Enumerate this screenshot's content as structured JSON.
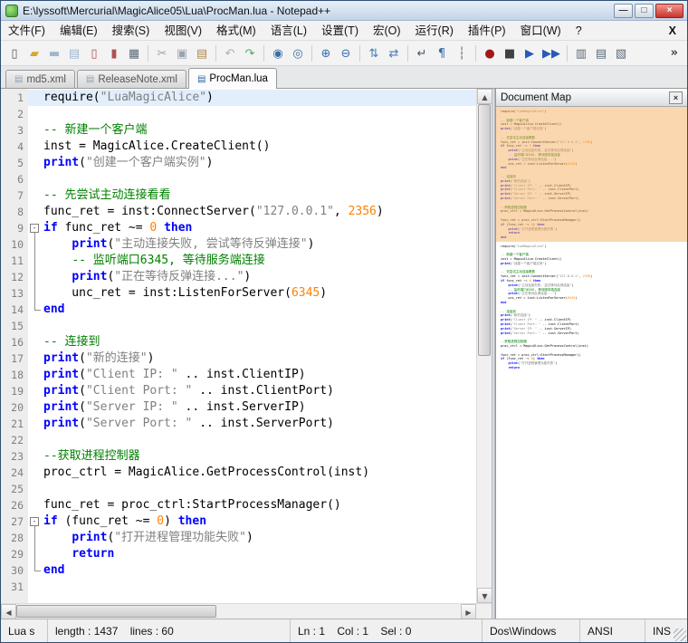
{
  "window": {
    "title": "E:\\lyssoft\\Mercurial\\MagicAlice05\\Lua\\ProcMan.lua - Notepad++",
    "buttons": {
      "minimize": "—",
      "maximize": "□",
      "close": "×"
    }
  },
  "menu": {
    "items": [
      "文件(F)",
      "编辑(E)",
      "搜索(S)",
      "视图(V)",
      "格式(M)",
      "语言(L)",
      "设置(T)",
      "宏(O)",
      "运行(R)",
      "插件(P)",
      "窗口(W)",
      "?"
    ],
    "close_label": "X"
  },
  "toolbar": {
    "overflow": "»",
    "items": [
      {
        "name": "new-file-icon",
        "glyph": "▯",
        "color": "#5a5a5a"
      },
      {
        "name": "open-folder-icon",
        "glyph": "▰",
        "color": "#d9a62e"
      },
      {
        "name": "save-icon",
        "glyph": "▬",
        "color": "#9fb6cf"
      },
      {
        "name": "save-all-icon",
        "glyph": "▤",
        "color": "#9fb6cf"
      },
      {
        "name": "close-doc-icon",
        "glyph": "▯",
        "color": "#b05050"
      },
      {
        "name": "close-all-docs-icon",
        "glyph": "▮",
        "color": "#b05050"
      },
      {
        "name": "print-icon",
        "glyph": "▦",
        "color": "#5a6a7a"
      },
      {
        "sep": true
      },
      {
        "name": "cut-icon",
        "glyph": "✂",
        "color": "#9aa4b0"
      },
      {
        "name": "copy-icon",
        "glyph": "▣",
        "color": "#9aa4b0"
      },
      {
        "name": "paste-icon",
        "glyph": "▤",
        "color": "#b08950"
      },
      {
        "sep": true
      },
      {
        "name": "undo-icon",
        "glyph": "↶",
        "color": "#b0b0b0"
      },
      {
        "name": "redo-icon",
        "glyph": "↷",
        "color": "#58a868"
      },
      {
        "sep": true
      },
      {
        "name": "find-icon",
        "glyph": "◉",
        "color": "#3a6ea5"
      },
      {
        "name": "replace-icon",
        "glyph": "◎",
        "color": "#3a6ea5"
      },
      {
        "sep": true
      },
      {
        "name": "zoom-in-icon",
        "glyph": "⊕",
        "color": "#3a6ea5"
      },
      {
        "name": "zoom-out-icon",
        "glyph": "⊖",
        "color": "#3a6ea5"
      },
      {
        "sep": true
      },
      {
        "name": "sync-vertical-icon",
        "glyph": "⇅",
        "color": "#4a7ab5"
      },
      {
        "name": "sync-horizontal-icon",
        "glyph": "⇄",
        "color": "#4a7ab5"
      },
      {
        "sep": true
      },
      {
        "name": "word-wrap-icon",
        "glyph": "↵",
        "color": "#4a5a6a"
      },
      {
        "name": "show-all-chars-icon",
        "glyph": "¶",
        "color": "#3a6ea5"
      },
      {
        "name": "indent-guide-icon",
        "glyph": "┆",
        "color": "#5a5a5a"
      },
      {
        "sep": true
      },
      {
        "name": "record-macro-icon",
        "glyph": "●",
        "color": "#a01818"
      },
      {
        "name": "stop-record-icon",
        "glyph": "■",
        "color": "#404040"
      },
      {
        "name": "play-macro-icon",
        "glyph": "▶",
        "color": "#2858b8"
      },
      {
        "name": "run-macro-multiple-icon",
        "glyph": "▶▶",
        "color": "#2858b8"
      },
      {
        "sep": true
      },
      {
        "name": "document-map-icon",
        "glyph": "▥",
        "color": "#5a6a7a"
      },
      {
        "name": "function-list-icon",
        "glyph": "▤",
        "color": "#5a6a7a"
      },
      {
        "name": "file-browser-icon",
        "glyph": "▧",
        "color": "#5a6a7a"
      }
    ]
  },
  "tabs": [
    {
      "label": "md5.xml",
      "active": false
    },
    {
      "label": "ReleaseNote.xml",
      "active": false
    },
    {
      "label": "ProcMan.lua",
      "active": true
    }
  ],
  "icons": {
    "tab_document": "▤",
    "arrow_up": "▲",
    "arrow_down": "▼",
    "arrow_left": "◀",
    "arrow_right": "▶",
    "docmap_close": "×"
  },
  "colors": {
    "keyword": "#0000ff",
    "string": "#808080",
    "number": "#ff8000",
    "comment": "#008000",
    "current_line_bg": "#e2eefb",
    "map_view_region": "#f7a74f"
  },
  "docmap": {
    "title": "Document Map"
  },
  "status": {
    "segments": [
      "Lua s",
      "length : 1437    lines : 60",
      "Ln : 1    Col : 1    Sel : 0",
      "Dos\\Windows",
      "ANSI",
      "INS"
    ]
  },
  "editor": {
    "lines": [
      {
        "n": 1,
        "current": true,
        "fold": "",
        "tokens": [
          [
            "p",
            "require("
          ],
          [
            "s",
            "\"LuaMagicAlice\""
          ],
          [
            "p",
            ")"
          ]
        ]
      },
      {
        "n": 2,
        "fold": "",
        "tokens": []
      },
      {
        "n": 3,
        "fold": "",
        "tokens": [
          [
            "c",
            "-- 新建一个客户端"
          ]
        ]
      },
      {
        "n": 4,
        "fold": "",
        "tokens": [
          [
            "p",
            "inst = MagicAlice.CreateClient()"
          ]
        ]
      },
      {
        "n": 5,
        "fold": "",
        "tokens": [
          [
            "k",
            "print"
          ],
          [
            "p",
            "("
          ],
          [
            "s",
            "\"创建一个客户端实例\""
          ],
          [
            "p",
            ")"
          ]
        ]
      },
      {
        "n": 6,
        "fold": "",
        "tokens": []
      },
      {
        "n": 7,
        "fold": "",
        "tokens": [
          [
            "c",
            "-- 先尝试主动连接看看"
          ]
        ]
      },
      {
        "n": 8,
        "fold": "",
        "tokens": [
          [
            "p",
            "func_ret = inst:ConnectServer("
          ],
          [
            "s",
            "\"127.0.0.1\""
          ],
          [
            "p",
            ", "
          ],
          [
            "n",
            "2356"
          ],
          [
            "p",
            ")"
          ]
        ]
      },
      {
        "n": 9,
        "fold": "start",
        "tokens": [
          [
            "k",
            "if"
          ],
          [
            "p",
            " func_ret ~= "
          ],
          [
            "n",
            "0"
          ],
          [
            "p",
            " "
          ],
          [
            "k",
            "then"
          ]
        ]
      },
      {
        "n": 10,
        "fold": "mid",
        "tokens": [
          [
            "p",
            "    "
          ],
          [
            "k",
            "print"
          ],
          [
            "p",
            "("
          ],
          [
            "s",
            "\"主动连接失败, 尝试等待反弹连接\""
          ],
          [
            "p",
            ")"
          ]
        ]
      },
      {
        "n": 11,
        "fold": "mid",
        "tokens": [
          [
            "p",
            "    "
          ],
          [
            "c",
            "-- 监听端口6345, 等待服务端连接"
          ]
        ]
      },
      {
        "n": 12,
        "fold": "mid",
        "tokens": [
          [
            "p",
            "    "
          ],
          [
            "k",
            "print"
          ],
          [
            "p",
            "("
          ],
          [
            "s",
            "\"正在等待反弹连接...\""
          ],
          [
            "p",
            ")"
          ]
        ]
      },
      {
        "n": 13,
        "fold": "mid",
        "tokens": [
          [
            "p",
            "    unc_ret = inst:ListenForServer("
          ],
          [
            "n",
            "6345"
          ],
          [
            "p",
            ")"
          ]
        ]
      },
      {
        "n": 14,
        "fold": "end",
        "tokens": [
          [
            "k",
            "end"
          ]
        ]
      },
      {
        "n": 15,
        "fold": "",
        "tokens": []
      },
      {
        "n": 16,
        "fold": "",
        "tokens": [
          [
            "c",
            "-- 连接到"
          ]
        ]
      },
      {
        "n": 17,
        "fold": "",
        "tokens": [
          [
            "k",
            "print"
          ],
          [
            "p",
            "("
          ],
          [
            "s",
            "\"新的连接\""
          ],
          [
            "p",
            ")"
          ]
        ]
      },
      {
        "n": 18,
        "fold": "",
        "tokens": [
          [
            "k",
            "print"
          ],
          [
            "p",
            "("
          ],
          [
            "s",
            "\"Client IP: \""
          ],
          [
            "p",
            " .. inst.ClientIP)"
          ]
        ]
      },
      {
        "n": 19,
        "fold": "",
        "tokens": [
          [
            "k",
            "print"
          ],
          [
            "p",
            "("
          ],
          [
            "s",
            "\"Client Port: \""
          ],
          [
            "p",
            " .. inst.ClientPort)"
          ]
        ]
      },
      {
        "n": 20,
        "fold": "",
        "tokens": [
          [
            "k",
            "print"
          ],
          [
            "p",
            "("
          ],
          [
            "s",
            "\"Server IP: \""
          ],
          [
            "p",
            " .. inst.ServerIP)"
          ]
        ]
      },
      {
        "n": 21,
        "fold": "",
        "tokens": [
          [
            "k",
            "print"
          ],
          [
            "p",
            "("
          ],
          [
            "s",
            "\"Server Port: \""
          ],
          [
            "p",
            " .. inst.ServerPort)"
          ]
        ]
      },
      {
        "n": 22,
        "fold": "",
        "tokens": []
      },
      {
        "n": 23,
        "fold": "",
        "tokens": [
          [
            "c",
            "--获取进程控制器"
          ]
        ]
      },
      {
        "n": 24,
        "fold": "",
        "tokens": [
          [
            "p",
            "proc_ctrl = MagicAlice.GetProcessControl(inst)"
          ]
        ]
      },
      {
        "n": 25,
        "fold": "",
        "tokens": []
      },
      {
        "n": 26,
        "fold": "",
        "tokens": [
          [
            "p",
            "func_ret = proc_ctrl:StartProcessManager()"
          ]
        ]
      },
      {
        "n": 27,
        "fold": "start",
        "tokens": [
          [
            "k",
            "if"
          ],
          [
            "p",
            " (func_ret ~= "
          ],
          [
            "n",
            "0"
          ],
          [
            "p",
            ") "
          ],
          [
            "k",
            "then"
          ]
        ]
      },
      {
        "n": 28,
        "fold": "mid",
        "tokens": [
          [
            "p",
            "    "
          ],
          [
            "k",
            "print"
          ],
          [
            "p",
            "("
          ],
          [
            "s",
            "\"打开进程管理功能失败\""
          ],
          [
            "p",
            ")"
          ]
        ]
      },
      {
        "n": 29,
        "fold": "mid",
        "tokens": [
          [
            "p",
            "    "
          ],
          [
            "k",
            "return"
          ]
        ]
      },
      {
        "n": 30,
        "fold": "end",
        "tokens": [
          [
            "k",
            "end"
          ]
        ]
      },
      {
        "n": 31,
        "fold": "",
        "tokens": []
      }
    ]
  }
}
